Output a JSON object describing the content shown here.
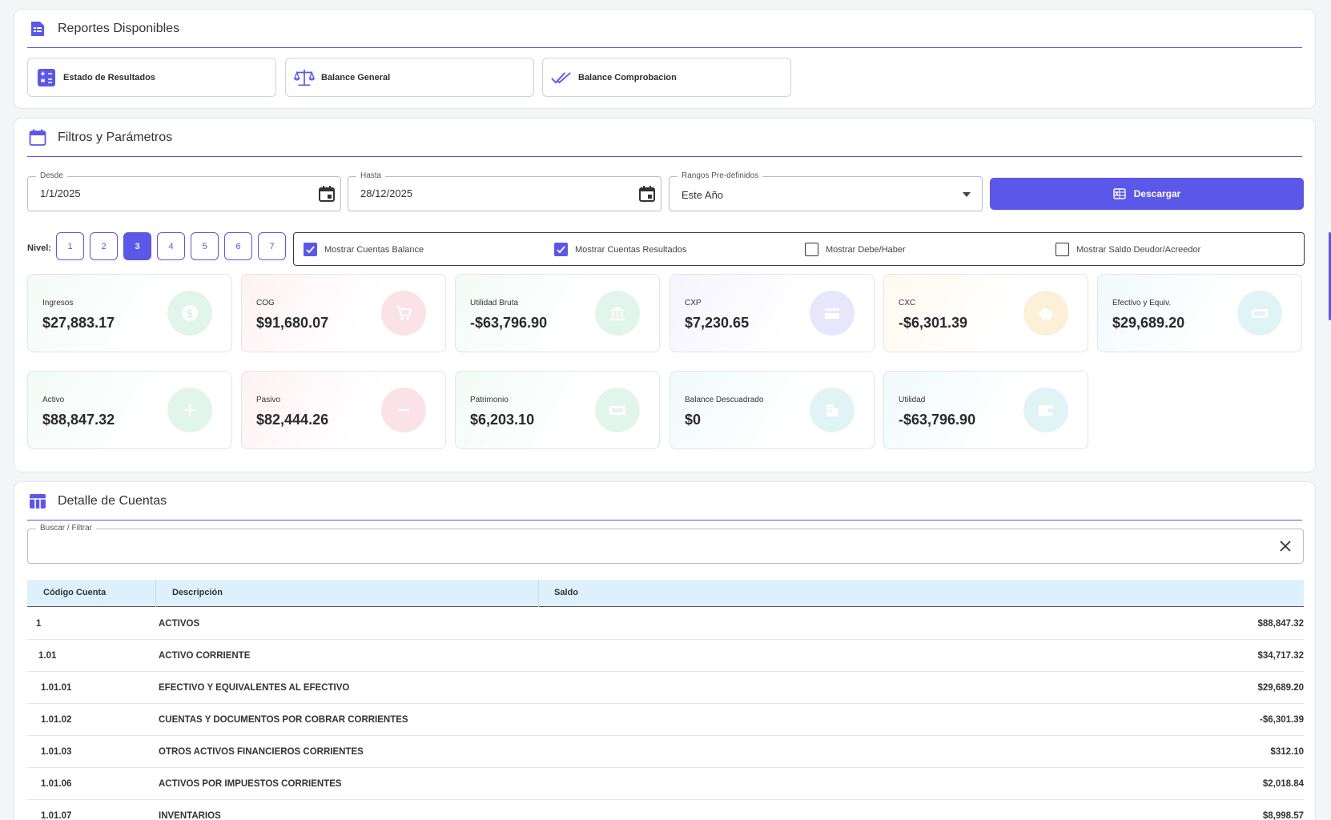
{
  "reports": {
    "title": "Reportes Disponibles",
    "buttons": [
      {
        "label": "Estado de Resultados",
        "icon": "calculator-icon"
      },
      {
        "label": "Balance General",
        "icon": "scale-icon"
      },
      {
        "label": "Balance Comprobacion",
        "icon": "double-check-icon"
      }
    ]
  },
  "filters": {
    "title": "Filtros y Parámetros",
    "desde": {
      "label": "Desde",
      "value": "1/1/2025"
    },
    "hasta": {
      "label": "Hasta",
      "value": "28/12/2025"
    },
    "rangos": {
      "label": "Rangos Pre-definidos",
      "value": "Este Año"
    },
    "download_label": "Descargar",
    "nivel_label": "Nivel:",
    "levels": [
      "1",
      "2",
      "3",
      "4",
      "5",
      "6",
      "7"
    ],
    "active_level": "3",
    "checkboxes": [
      {
        "label": "Mostrar Cuentas Balance",
        "checked": true
      },
      {
        "label": "Mostrar Cuentas Resultados",
        "checked": true
      },
      {
        "label": "Mostrar Debe/Haber",
        "checked": false
      },
      {
        "label": "Mostrar Saldo Deudor/Acreedor",
        "checked": false
      }
    ]
  },
  "kpis": [
    {
      "label": "Ingresos",
      "value": "$27,883.17",
      "icon": "dollar-coin-icon",
      "color": "#34c38f"
    },
    {
      "label": "COG",
      "value": "$91,680.07",
      "icon": "cart-icon",
      "color": "#f46a8a"
    },
    {
      "label": "Utilidad Bruta",
      "value": "-$63,796.90",
      "icon": "bank-icon",
      "color": "#34c38f"
    },
    {
      "label": "CXP",
      "value": "$7,230.65",
      "icon": "credit-card-icon",
      "color": "#8d84f0"
    },
    {
      "label": "CXC",
      "value": "-$6,301.39",
      "icon": "piggy-bank-icon",
      "color": "#f7b84b"
    },
    {
      "label": "Efectivo y Equiv.",
      "value": "$29,689.20",
      "icon": "cash-icon",
      "color": "#50c5d0"
    },
    {
      "label": "Activo",
      "value": "$88,847.32",
      "icon": "plus-icon",
      "color": "#34c38f"
    },
    {
      "label": "Pasivo",
      "value": "$82,444.26",
      "icon": "minus-icon",
      "color": "#f46a8a"
    },
    {
      "label": "Patrimonio",
      "value": "$6,203.10",
      "icon": "cash-icon",
      "color": "#34c38f"
    },
    {
      "label": "Balance Descuadrado",
      "value": "$0",
      "icon": "building-icon",
      "color": "#50c5d0"
    },
    {
      "label": "Utilidad",
      "value": "-$63,796.90",
      "icon": "wallet-icon",
      "color": "#50c5d0"
    }
  ],
  "details": {
    "title": "Detalle de Cuentas",
    "search_label": "Buscar / Filtrar",
    "columns": [
      "Código Cuenta",
      "Descripción",
      "Saldo"
    ],
    "rows": [
      {
        "code": "1",
        "desc": "ACTIVOS",
        "saldo": "$88,847.32"
      },
      {
        "code": "1.01",
        "desc": "ACTIVO CORRIENTE",
        "saldo": "$34,717.32"
      },
      {
        "code": "1.01.01",
        "desc": "EFECTIVO Y EQUIVALENTES AL EFECTIVO",
        "saldo": "$29,689.20"
      },
      {
        "code": "1.01.02",
        "desc": "CUENTAS Y DOCUMENTOS POR COBRAR CORRIENTES",
        "saldo": "-$6,301.39"
      },
      {
        "code": "1.01.03",
        "desc": "OTROS ACTIVOS FINANCIEROS CORRIENTES",
        "saldo": "$312.10"
      },
      {
        "code": "1.01.06",
        "desc": "ACTIVOS POR IMPUESTOS CORRIENTES",
        "saldo": "$2,018.84"
      },
      {
        "code": "1.01.07",
        "desc": "INVENTARIOS",
        "saldo": "$8,998.57"
      }
    ]
  },
  "accent": "#5b57e8"
}
